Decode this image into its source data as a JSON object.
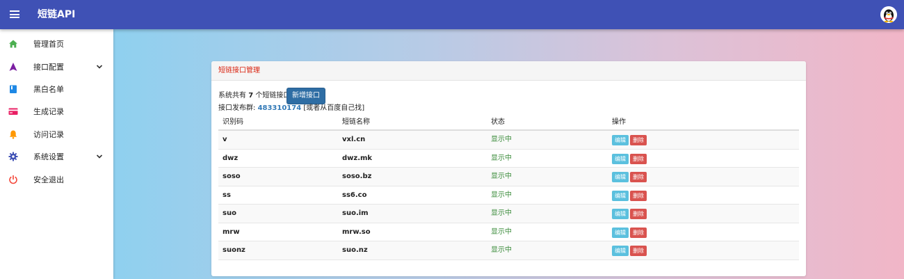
{
  "header": {
    "title": "短链API",
    "menu_icon": "hamburger-menu-icon",
    "avatar_icon": "qq-penguin-avatar",
    "color": "#3f51b5"
  },
  "sidebar": {
    "items": [
      {
        "label": "管理首页",
        "icon": "home-icon",
        "color": "#4caf50",
        "has_submenu": false
      },
      {
        "label": "接口配置",
        "icon": "navigation-arrow-icon",
        "color": "#7b1fa2",
        "has_submenu": true
      },
      {
        "label": "黑白名单",
        "icon": "book-icon",
        "color": "#1e88e5",
        "has_submenu": false
      },
      {
        "label": "生成记录",
        "icon": "card-icon",
        "color": "#e91e63",
        "has_submenu": false
      },
      {
        "label": "访问记录",
        "icon": "bell-icon",
        "color": "#ff9800",
        "has_submenu": false
      },
      {
        "label": "系统设置",
        "icon": "gear-icon",
        "color": "#3f51b5",
        "has_submenu": true
      },
      {
        "label": "安全退出",
        "icon": "power-icon",
        "color": "#f44336",
        "has_submenu": false
      }
    ]
  },
  "card": {
    "title": "短链接口管理",
    "summary_prefix": "系统共有",
    "summary_count": "7",
    "summary_suffix": "个短链接口",
    "add_button": "新增接口",
    "group_label": "接口发布群:",
    "group_number": "483310174",
    "group_note": "[或者从百度自己找]"
  },
  "table": {
    "columns": [
      "识别码",
      "短链名称",
      "状态",
      "操作"
    ],
    "edit_label": "编辑",
    "delete_label": "删除",
    "rows": [
      {
        "code": "v",
        "name": "vxl.cn",
        "status": "显示中"
      },
      {
        "code": "dwz",
        "name": "dwz.mk",
        "status": "显示中"
      },
      {
        "code": "soso",
        "name": "soso.bz",
        "status": "显示中"
      },
      {
        "code": "ss",
        "name": "ss6.co",
        "status": "显示中"
      },
      {
        "code": "suo",
        "name": "suo.im",
        "status": "显示中"
      },
      {
        "code": "mrw",
        "name": "mrw.so",
        "status": "显示中"
      },
      {
        "code": "suonz",
        "name": "suo.nz",
        "status": "显示中"
      }
    ]
  }
}
